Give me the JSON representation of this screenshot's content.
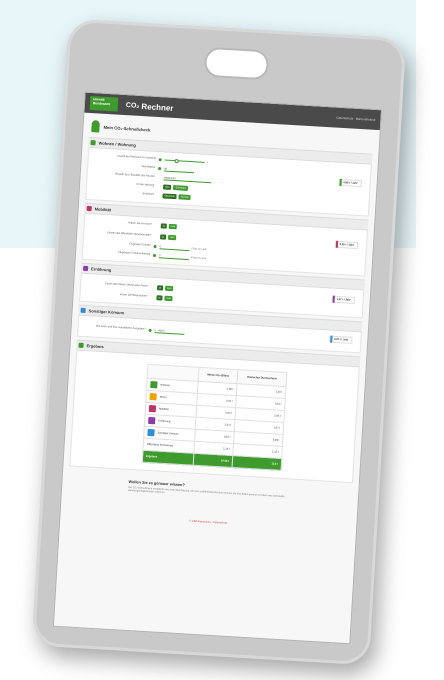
{
  "header": {
    "logo_text": "Umwelt Bundesamt",
    "brand": "Rechner",
    "nav_links": "Datenschutz · Barrierefreiheit"
  },
  "page": {
    "title": "Mein CO₂-Schnellcheck"
  },
  "sections": {
    "wohnen": {
      "title": "Wohnen / Wohnung",
      "rows": [
        {
          "label": "Anzahl der Personen im Haushalt",
          "value": "1"
        },
        {
          "label": "Wohnfläche",
          "value": "30"
        },
        {
          "label": "Baujahr bzw. Baualter des Hauses",
          "value": "unbekannt"
        },
        {
          "label": "Art der Heizung",
          "btn1": "Gas",
          "btn2": "Sonstiges"
        },
        {
          "label": "Stromtarif",
          "btn1": "Ökostrom",
          "btn2": "Normal"
        }
      ],
      "result": "0,86 t / Jahr",
      "color": "#3f9b2e"
    },
    "mobilitaet": {
      "title": "Mobilität",
      "rows": [
        {
          "label": "Haben Sie ein Auto?",
          "btn1": "ja",
          "btn2": "nein"
        },
        {
          "label": "Nutzen Sie öffentliche Verkehrsmittel?",
          "btn1": "ja",
          "btn2": "nein"
        },
        {
          "label": "Flugreisen Europa",
          "value": "0",
          "unit": "Flüge pro Jahr"
        },
        {
          "label": "Flugreisen Transkontinental",
          "value": "0",
          "unit": "Flüge pro Jahr"
        }
      ],
      "result": "0,00 t / Jahr",
      "color": "#c0326a"
    },
    "ernaehrung": {
      "title": "Ernährung",
      "rows": [
        {
          "label": "Essen Sie Fleisch, Wurst oder Fisch?",
          "btn1": "ja",
          "btn2": "nein"
        },
        {
          "label": "Essen Sie Bioprodukte?",
          "btn1": "ja",
          "btn2": "nein"
        }
      ],
      "result": "1,57 t / Jahr",
      "color": "#8a3fa8"
    },
    "konsum": {
      "title": "Sonstiger Konsum",
      "rows": [
        {
          "label": "Wie hoch sind Ihre monatlichen Ausgaben?",
          "value": "0 - 400 €"
        }
      ],
      "result": "0,87 t / Jahr",
      "color": "#2f8fd6"
    },
    "ergebnis": {
      "title": "Ergebnis"
    }
  },
  "results_table": {
    "col_headers": [
      "",
      "Meine CO₂-Bilanz",
      "Deutscher Durchschnitt"
    ],
    "rows": [
      {
        "category": "Wohnen",
        "mine": "0,86 t",
        "avg": "2,16 t",
        "icon_color": "#3f9b2e",
        "icon": "house-icon"
      },
      {
        "category": "Strom",
        "mine": "0,01 t",
        "avg": "0,61 t",
        "icon_color": "#f0a400",
        "icon": "bolt-icon"
      },
      {
        "category": "Mobilität",
        "mine": "0,00 t",
        "avg": "2,05 t",
        "icon_color": "#c0326a",
        "icon": "car-icon"
      },
      {
        "category": "Ernährung",
        "mine": "1,57 t",
        "avg": "1,57 t",
        "icon_color": "#8a3fa8",
        "icon": "food-icon"
      },
      {
        "category": "Sonstiger Konsum",
        "mine": "0,87 t",
        "avg": "3,83 t",
        "icon_color": "#2f8fd6",
        "icon": "bag-icon"
      },
      {
        "category": "Öffentliche Emissionen",
        "mine": "1,15 t",
        "avg": "1,15 t",
        "icon_color": "",
        "icon": ""
      }
    ],
    "total": {
      "label": "Ergebnis",
      "mine": "10,46 t",
      "avg": "11,6 t"
    }
  },
  "cta": {
    "title": "Wollen Sie es genauer wissen?",
    "text": "Der CO₂-Schnellcheck ermöglicht eine erste Abschätzung. Mit dem ausführlichen Rechner können Sie Ihre Bilanz genauer ermitteln und individuelle Handlungsmöglichkeiten erkennen."
  },
  "footer": {
    "link": "© UBA Impressum · Datenschutz"
  }
}
